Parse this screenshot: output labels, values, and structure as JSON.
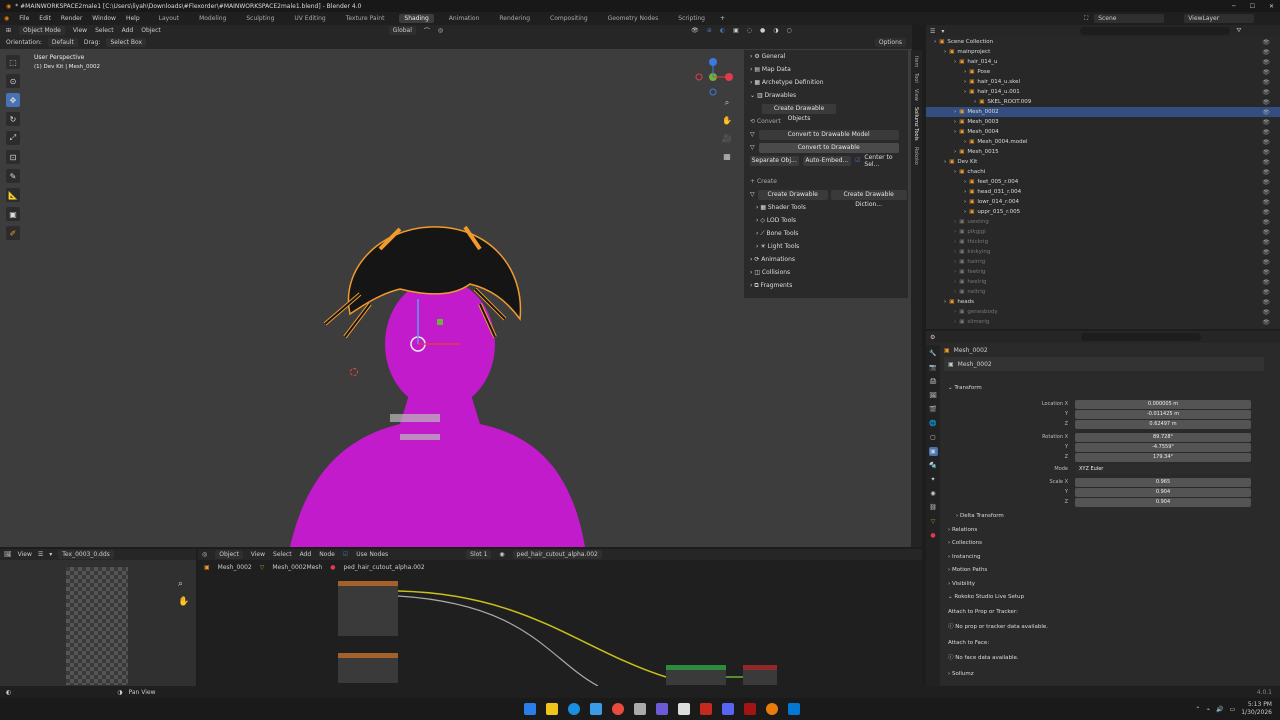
{
  "title_bar": {
    "title": "* #MAINWORKSPACE2male1 [C:\\Users\\liyah\\Downloads\\#Flexorder\\#MAINWORKSPACE2male1.blend] - Blender 4.0",
    "minimize": "─",
    "maximize": "☐",
    "close": "✕"
  },
  "menu": {
    "items": [
      "File",
      "Edit",
      "Render",
      "Window",
      "Help"
    ],
    "workspaces": [
      "Layout",
      "Modeling",
      "Sculpting",
      "UV Editing",
      "Texture Paint",
      "Shading",
      "Animation",
      "Rendering",
      "Compositing",
      "Geometry Nodes",
      "Scripting"
    ],
    "active_workspace": "Shading",
    "add_tab": "+",
    "scene": "Scene",
    "view_layer": "ViewLayer"
  },
  "viewport_header": {
    "mode": "Object Mode",
    "menus": [
      "View",
      "Select",
      "Add",
      "Object"
    ],
    "transform": "Global",
    "options": "Options",
    "orientation_label": "Orientation:",
    "orientation_value": "Default",
    "drag_label": "Drag:",
    "drag_value": "Select Box"
  },
  "viewport": {
    "overlay_title": "User Perspective",
    "overlay_sub": "(1) Dev Kit | Mesh_0002"
  },
  "sidebar": {
    "general": "General",
    "map_data": "Map Data",
    "archetype": "Archetype Definition",
    "drawables": "Drawables",
    "create_drawable_objects": "Create Drawable Objects",
    "convert": "Convert",
    "convert_to_drawable_model": "Convert to Drawable Model",
    "convert_to_drawable": "Convert to Drawable",
    "separate_obj": "Separate Obj...",
    "auto_embed": "Auto-Embed...",
    "center_to_sel": "Center to Sel...",
    "create": "Create",
    "create_drawable": "Create Drawable",
    "create_drawable_dict": "Create Drawable Diction...",
    "shader_tools": "Shader Tools",
    "lod_tools": "LOD Tools",
    "bone_tools": "Bone Tools",
    "light_tools": "Light Tools",
    "animations": "Animations",
    "collisions": "Collisions",
    "fragments": "Fragments",
    "tabs": [
      "Item",
      "Tool",
      "View",
      "Sollumz Tools",
      "Rokoko"
    ]
  },
  "outliner": {
    "rows": [
      {
        "label": "Scene Collection",
        "indent": 0,
        "state": "normal"
      },
      {
        "label": "mainproject",
        "indent": 1,
        "state": "normal"
      },
      {
        "label": "hair_014_u",
        "indent": 2,
        "state": "normal"
      },
      {
        "label": "Pose",
        "indent": 3,
        "state": "normal"
      },
      {
        "label": "hair_014_u.skel",
        "indent": 3,
        "state": "normal"
      },
      {
        "label": "hair_014_u.001",
        "indent": 3,
        "state": "normal"
      },
      {
        "label": "SKEL_ROOT.009",
        "indent": 4,
        "state": "normal"
      },
      {
        "label": "Mesh_0002",
        "indent": 2,
        "state": "selected"
      },
      {
        "label": "Mesh_0003",
        "indent": 2,
        "state": "normal"
      },
      {
        "label": "Mesh_0004",
        "indent": 2,
        "state": "normal"
      },
      {
        "label": "Mesh_0004.model",
        "indent": 3,
        "state": "normal"
      },
      {
        "label": "Mesh_0015",
        "indent": 2,
        "state": "normal"
      },
      {
        "label": "Dev Kit",
        "indent": 1,
        "state": "normal"
      },
      {
        "label": "chachi",
        "indent": 2,
        "state": "normal"
      },
      {
        "label": "feet_005_r.004",
        "indent": 3,
        "state": "normal"
      },
      {
        "label": "head_031_r.004",
        "indent": 3,
        "state": "normal"
      },
      {
        "label": "lowr_014_r.004",
        "indent": 3,
        "state": "normal"
      },
      {
        "label": "uppr_015_r.005",
        "indent": 3,
        "state": "normal"
      },
      {
        "label": "uwsting",
        "indent": 2,
        "state": "dim"
      },
      {
        "label": "plkgjgi",
        "indent": 2,
        "state": "dim"
      },
      {
        "label": "thickrig",
        "indent": 2,
        "state": "dim"
      },
      {
        "label": "kinkying",
        "indent": 2,
        "state": "dim"
      },
      {
        "label": "hairrig",
        "indent": 2,
        "state": "dim"
      },
      {
        "label": "feetrig",
        "indent": 2,
        "state": "dim"
      },
      {
        "label": "heelrig",
        "indent": 2,
        "state": "dim"
      },
      {
        "label": "neltrig",
        "indent": 2,
        "state": "dim"
      },
      {
        "label": "heads",
        "indent": 1,
        "state": "normal"
      },
      {
        "label": "genesbody",
        "indent": 2,
        "state": "dim"
      },
      {
        "label": "slimerig",
        "indent": 2,
        "state": "dim"
      }
    ]
  },
  "properties": {
    "object_name": "Mesh_0002",
    "breadcrumb": "Mesh_0002",
    "transform": "Transform",
    "location_label": "Location X",
    "rotation_label": "Rotation X",
    "scale_label": "Scale X",
    "y": "Y",
    "z": "Z",
    "location": [
      "0.000005 m",
      "-0.011425 m",
      "0.62497 m"
    ],
    "rotation": [
      "89.728°",
      "-4.7559°",
      "179.34°"
    ],
    "mode_label": "Mode",
    "mode": "XYZ Euler",
    "scale": [
      "0.965",
      "0.904",
      "0.904"
    ],
    "delta_transform": "Delta Transform",
    "sections": [
      "Relations",
      "Collections",
      "Instancing",
      "Motion Paths",
      "Visibility",
      "Rokoko Studio Live Setup"
    ],
    "attach_prop": "Attach to Prop or Tracker:",
    "no_prop": "No prop or tracker data available.",
    "attach_face": "Attach to Face:",
    "no_face": "No face data available.",
    "sollumz": "Sollumz"
  },
  "image_editor": {
    "view": "View",
    "image": "Tex_0003_0.dds"
  },
  "node_editor": {
    "object": "Object",
    "menus": [
      "View",
      "Select",
      "Add",
      "Node"
    ],
    "use_nodes": "Use Nodes",
    "slot": "Slot 1",
    "material": "ped_hair_cutout_alpha.002",
    "breadcrumb": [
      "Mesh_0002",
      "Mesh_0002Mesh",
      "ped_hair_cutout_alpha.002"
    ]
  },
  "status_bar": {
    "pan": "Pan View",
    "version": "4.0.1"
  },
  "taskbar": {
    "time": "5:13 PM",
    "date": "1/30/2026"
  },
  "colors": {
    "accent": "#4772b3",
    "selection_outline": "#f19b2d",
    "mesh_pink": "#c21bcc",
    "viewport_bg": "#3d3d3d"
  }
}
